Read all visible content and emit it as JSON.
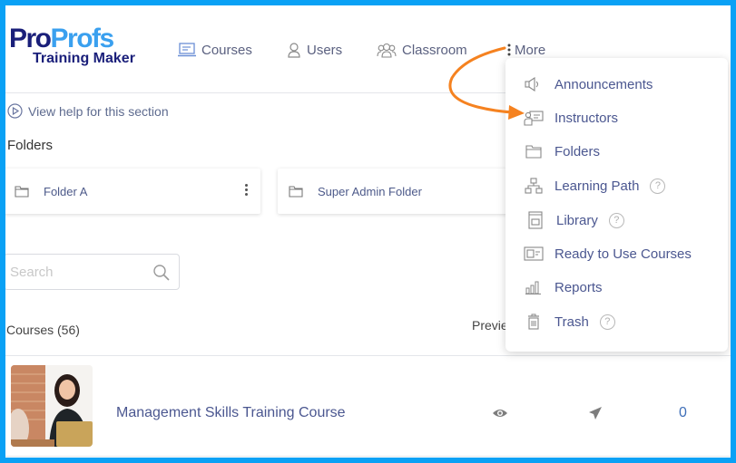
{
  "brand": {
    "logo_part1": "Pro",
    "logo_part2": "Profs",
    "logo_subtitle": "Training Maker",
    "colors": {
      "primary": "#1a1f7a",
      "accent": "#3aa0ef",
      "annotation_arrow": "#f58220",
      "frame": "#0aa1f5"
    }
  },
  "nav": {
    "items": [
      {
        "label": "Courses",
        "icon": "laptop-icon"
      },
      {
        "label": "Users",
        "icon": "user-icon"
      },
      {
        "label": "Classroom",
        "icon": "group-icon"
      },
      {
        "label": "More",
        "icon": "kebab-icon"
      }
    ]
  },
  "help": {
    "label": "View help for this section",
    "icon": "play-circle-icon"
  },
  "folders": {
    "title": "Folders",
    "items": [
      {
        "name": "Folder A",
        "icon": "folder-icon"
      },
      {
        "name": "Super Admin Folder",
        "icon": "folder-icon"
      }
    ]
  },
  "search": {
    "placeholder": "Search",
    "value": ""
  },
  "courses": {
    "count_label": "Courses (56)",
    "preview_header": "Previe",
    "rows": [
      {
        "title": "Management Skills Training Course",
        "count": "0"
      }
    ]
  },
  "more_menu": {
    "items": [
      {
        "label": "Announcements",
        "icon": "megaphone-icon",
        "help": false
      },
      {
        "label": "Instructors",
        "icon": "instructor-board-icon",
        "help": false
      },
      {
        "label": "Folders",
        "icon": "folder-icon",
        "help": false
      },
      {
        "label": "Learning Path",
        "icon": "hierarchy-icon",
        "help": true
      },
      {
        "label": "Library",
        "icon": "library-icon",
        "help": true
      },
      {
        "label": "Ready to Use Courses",
        "icon": "ready-course-icon",
        "help": false
      },
      {
        "label": "Reports",
        "icon": "bar-chart-icon",
        "help": false
      },
      {
        "label": "Trash",
        "icon": "trash-icon",
        "help": true
      }
    ],
    "help_glyph": "?"
  }
}
